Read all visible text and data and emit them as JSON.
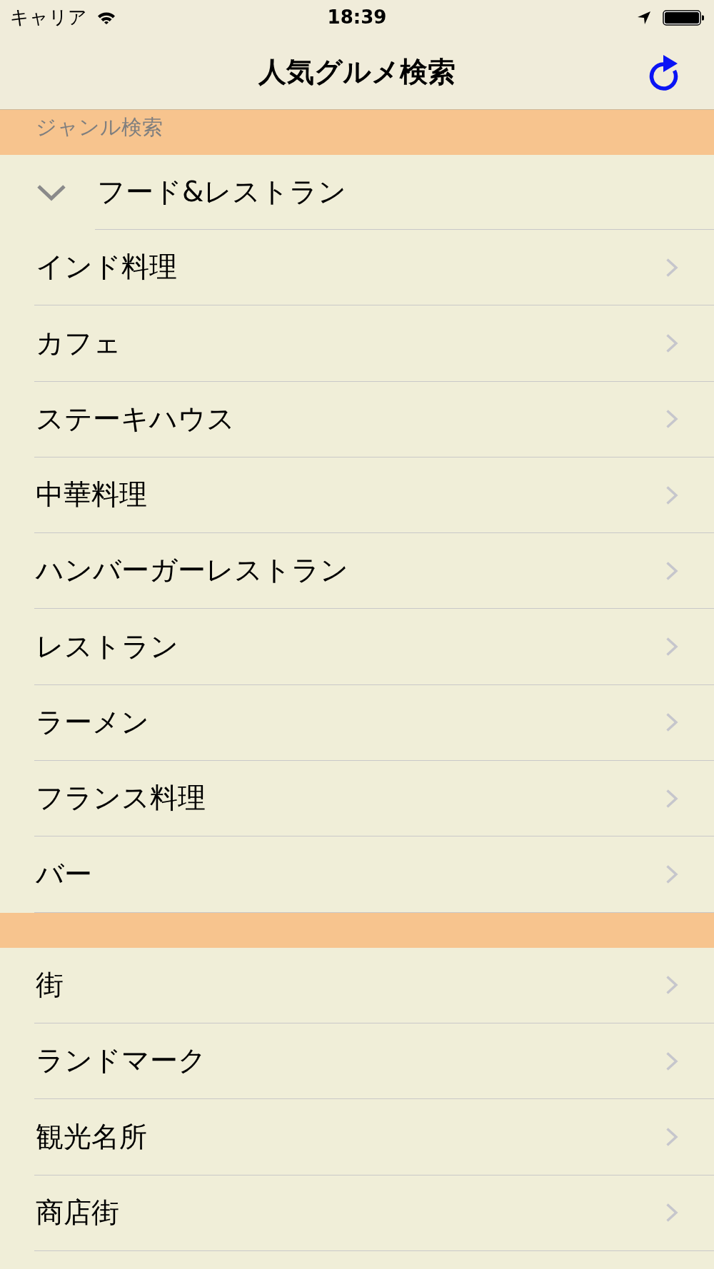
{
  "status_bar": {
    "carrier": "キャリア",
    "time": "18:39"
  },
  "nav_bar": {
    "title": "人気グルメ検索"
  },
  "sections": [
    {
      "header": "ジャンル検索",
      "group": {
        "label": "フード&レストラン",
        "expanded": true
      },
      "items": [
        "インド料理",
        "カフェ",
        "ステーキハウス",
        "中華料理",
        "ハンバーガーレストラン",
        "レストラン",
        "ラーメン",
        "フランス料理",
        "バー"
      ]
    },
    {
      "items": [
        "街",
        "ランドマーク",
        "観光名所",
        "商店街"
      ]
    }
  ]
}
